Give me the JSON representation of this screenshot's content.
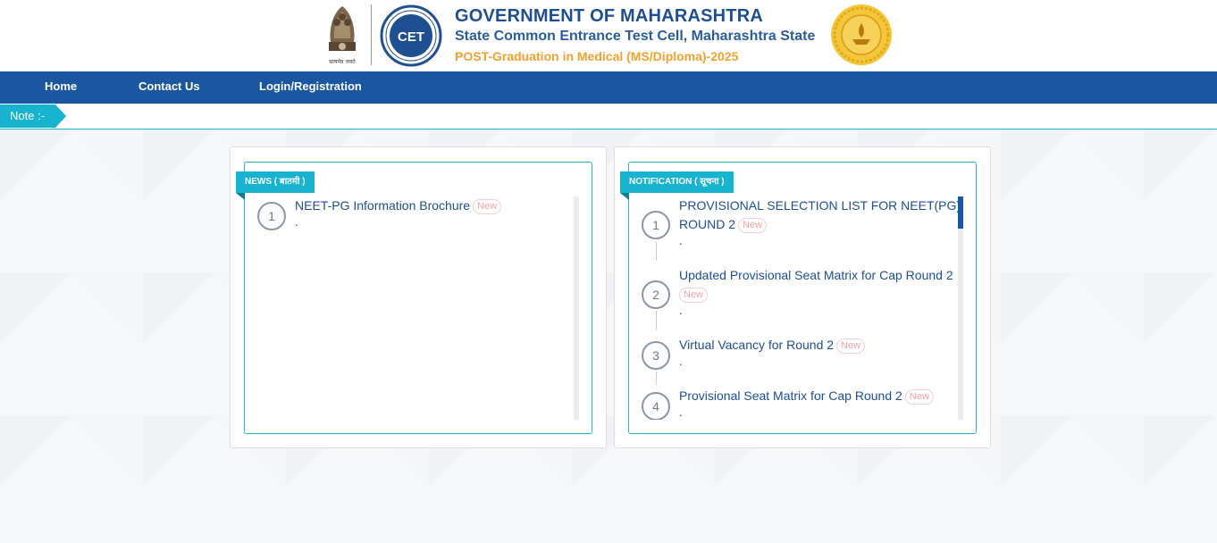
{
  "header": {
    "title": "GOVERNMENT OF MAHARASHTRA",
    "subtitle": "State Common Entrance Test Cell, Maharashtra State",
    "course": "POST-Graduation in Medical (MS/Diploma)-2025",
    "cet_logo_text": "CET",
    "emblem_caption": "सत्यमेव जयते"
  },
  "nav": {
    "home": "Home",
    "contact": "Contact Us",
    "login": "Login/Registration"
  },
  "note": {
    "label": "Note :-"
  },
  "news": {
    "tag": "NEWS ( बातमी )",
    "items": [
      {
        "number": "1",
        "title": "NEET-PG Information Brochure",
        "badge": "New",
        "trail": "."
      }
    ]
  },
  "notifications": {
    "tag": "NOTIFICATION ( सूचना )",
    "items": [
      {
        "number": "1",
        "title_line1": "PROVISIONAL SELECTION LIST FOR NEET(PG)",
        "title_line2": "ROUND 2",
        "badge": "New",
        "trail": "."
      },
      {
        "number": "2",
        "title_line1": "Updated Provisional Seat Matrix for Cap Round 2",
        "badge": "New",
        "trail": "."
      },
      {
        "number": "3",
        "title_line1": "Virtual Vacancy for Round 2",
        "badge": "New",
        "trail": "."
      },
      {
        "number": "4",
        "title_line1": "Provisional Seat Matrix for Cap Round 2",
        "badge": "New",
        "trail": "."
      }
    ]
  },
  "colors": {
    "nav_bg": "#1b57a0",
    "accent_teal": "#17b3cf",
    "title_blue": "#1d4f91",
    "course_orange": "#f2a12d"
  }
}
